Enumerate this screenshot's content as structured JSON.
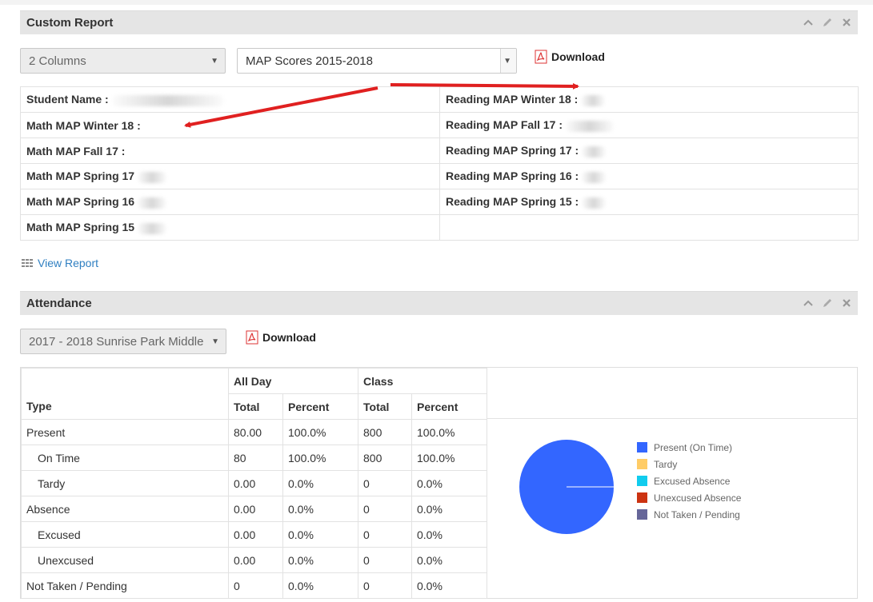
{
  "custom_report": {
    "title": "Custom Report",
    "columns_select": "2 Columns",
    "report_select": "MAP Scores 2015-2018",
    "download_label": "Download",
    "rows": [
      {
        "left": "Student Name :",
        "right": "Reading MAP Winter 18 :"
      },
      {
        "left": "Math MAP Winter 18 :",
        "right": "Reading MAP Fall 17 :"
      },
      {
        "left": "Math MAP Fall 17 :",
        "right": "Reading MAP Spring 17 :"
      },
      {
        "left": "Math MAP Spring 17",
        "right": "Reading MAP Spring 16 :"
      },
      {
        "left": "Math MAP Spring 16",
        "right": "Reading MAP Spring 15 :"
      },
      {
        "left": "Math MAP Spring 15",
        "right": ""
      }
    ],
    "view_report_label": "View Report"
  },
  "attendance": {
    "title": "Attendance",
    "school_select": "2017 - 2018 Sunrise Park Middle",
    "download_label": "Download",
    "headers": {
      "type": "Type",
      "all_day": "All Day",
      "class": "Class",
      "total": "Total",
      "percent": "Percent"
    },
    "rows": [
      {
        "type": "Present",
        "ad_total": "80.00",
        "ad_pct": "100.0%",
        "cl_total": "800",
        "cl_pct": "100.0%"
      },
      {
        "type": "On Time",
        "ad_total": "80",
        "ad_pct": "100.0%",
        "cl_total": "800",
        "cl_pct": "100.0%"
      },
      {
        "type": "Tardy",
        "ad_total": "0.00",
        "ad_pct": "0.0%",
        "cl_total": "0",
        "cl_pct": "0.0%"
      },
      {
        "type": "Absence",
        "ad_total": "0.00",
        "ad_pct": "0.0%",
        "cl_total": "0",
        "cl_pct": "0.0%"
      },
      {
        "type": "Excused",
        "ad_total": "0.00",
        "ad_pct": "0.0%",
        "cl_total": "0",
        "cl_pct": "0.0%"
      },
      {
        "type": "Unexcused",
        "ad_total": "0.00",
        "ad_pct": "0.0%",
        "cl_total": "0",
        "cl_pct": "0.0%"
      },
      {
        "type": "Not Taken / Pending",
        "ad_total": "0",
        "ad_pct": "0.0%",
        "cl_total": "0",
        "cl_pct": "0.0%"
      }
    ],
    "legend": [
      {
        "label": "Present (On Time)",
        "color": "#3366ff"
      },
      {
        "label": "Tardy",
        "color": "#ffcc66"
      },
      {
        "label": "Excused Absence",
        "color": "#11ccee"
      },
      {
        "label": "Unexcused Absence",
        "color": "#cc3311"
      },
      {
        "label": "Not Taken / Pending",
        "color": "#666699"
      }
    ]
  },
  "icons": [
    "chevron-up-icon",
    "pencil-icon",
    "close-icon",
    "pdf-icon",
    "list-icon",
    "dropdown-arrow-icon"
  ],
  "colors": {
    "header_bg": "#e5e5e5",
    "link": "#2f7fc1",
    "annotation_arrow": "#e02020",
    "pie_fill": "#3366ff"
  },
  "chart_data": {
    "type": "pie",
    "categories": [
      "Present (On Time)",
      "Tardy",
      "Excused Absence",
      "Unexcused Absence",
      "Not Taken / Pending"
    ],
    "values": [
      100,
      0,
      0,
      0,
      0
    ],
    "colors": [
      "#3366ff",
      "#ffcc66",
      "#11ccee",
      "#cc3311",
      "#666699"
    ],
    "legend_position": "right"
  }
}
